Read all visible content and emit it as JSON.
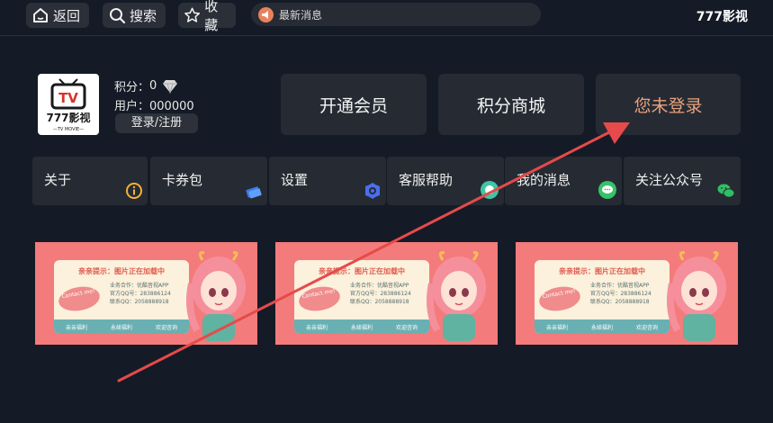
{
  "topbar": {
    "back_label": "返回",
    "search_label": "搜索",
    "favorite_label": "收藏",
    "news_label": "最新消息",
    "brand": "777影视"
  },
  "profile": {
    "logo_text_tv": "TV",
    "logo_text_name": "777影视",
    "logo_text_sub": "—TV MOVIE—",
    "points_label": "积分：",
    "points_value": "0",
    "user_label": "用户：",
    "user_value": "000000",
    "login_label": "登录/注册"
  },
  "actions": {
    "vip_label": "开通会员",
    "mall_label": "积分商城",
    "not_logged_label": "您未登录"
  },
  "menu": [
    {
      "label": "关于",
      "icon": "info-icon"
    },
    {
      "label": "卡券包",
      "icon": "ticket-icon"
    },
    {
      "label": "设置",
      "icon": "gear-icon"
    },
    {
      "label": "客服帮助",
      "icon": "support-icon"
    },
    {
      "label": "我的消息",
      "icon": "message-icon"
    },
    {
      "label": "关注公众号",
      "icon": "wechat-icon"
    }
  ],
  "banner": {
    "title": "亲亲提示：图片正在加载中",
    "line1": "业务合作：",
    "line1_val": "优酷音视APP",
    "line2": "官方QQ号：",
    "line2_val": "283886124",
    "line3": "联系QQ：",
    "line3_val": "2058888918",
    "stamp": "Contact me!",
    "footer1": "亲亲福利",
    "footer2": "永续福利",
    "footer3": "欢迎咨询"
  },
  "colors": {
    "background": "#141b26",
    "panel": "#262b33",
    "accent_orange": "#e9a27e",
    "arrow_red": "#e64a4a",
    "banner_pink": "#f47b7b"
  }
}
